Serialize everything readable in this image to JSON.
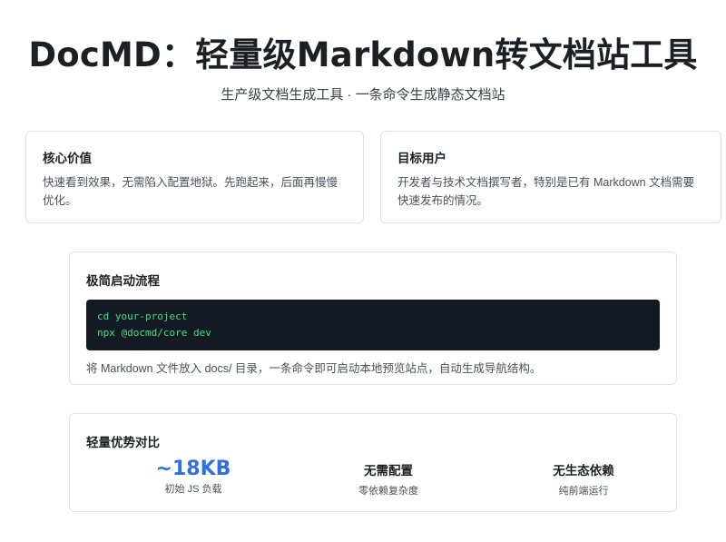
{
  "header": {
    "title": "DocMD：轻量级Markdown转文档站工具",
    "subtitle": "生产级文档生成工具 · 一条命令生成静态文档站"
  },
  "cards": {
    "core_value": {
      "title": "核心价值",
      "text": "快速看到效果，无需陷入配置地狱。先跑起来，后面再慢慢优化。"
    },
    "target_users": {
      "title": "目标用户",
      "text": "开发者与技术文档撰写者，特别是已有 Markdown 文档需要快速发布的情况。"
    }
  },
  "quickstart": {
    "title": "极简启动流程",
    "code_lines": [
      "cd your-project",
      "npx @docmd/core dev"
    ],
    "note": "将 Markdown 文件放入 docs/ 目录，一条命令即可启动本地预览站点，自动生成导航结构。"
  },
  "compare": {
    "title": "轻量优势对比",
    "stats": [
      {
        "value": "~18KB",
        "label": "初始 JS 负载"
      },
      {
        "value": "无需配置",
        "label": "零依赖复杂度"
      },
      {
        "value": "无生态依赖",
        "label": "纯前端运行"
      }
    ]
  },
  "colors": {
    "accent_blue": "#2f6fe4",
    "code_bg": "#141a24",
    "code_text": "#4ade80",
    "card_border": "#dfe3e8"
  }
}
